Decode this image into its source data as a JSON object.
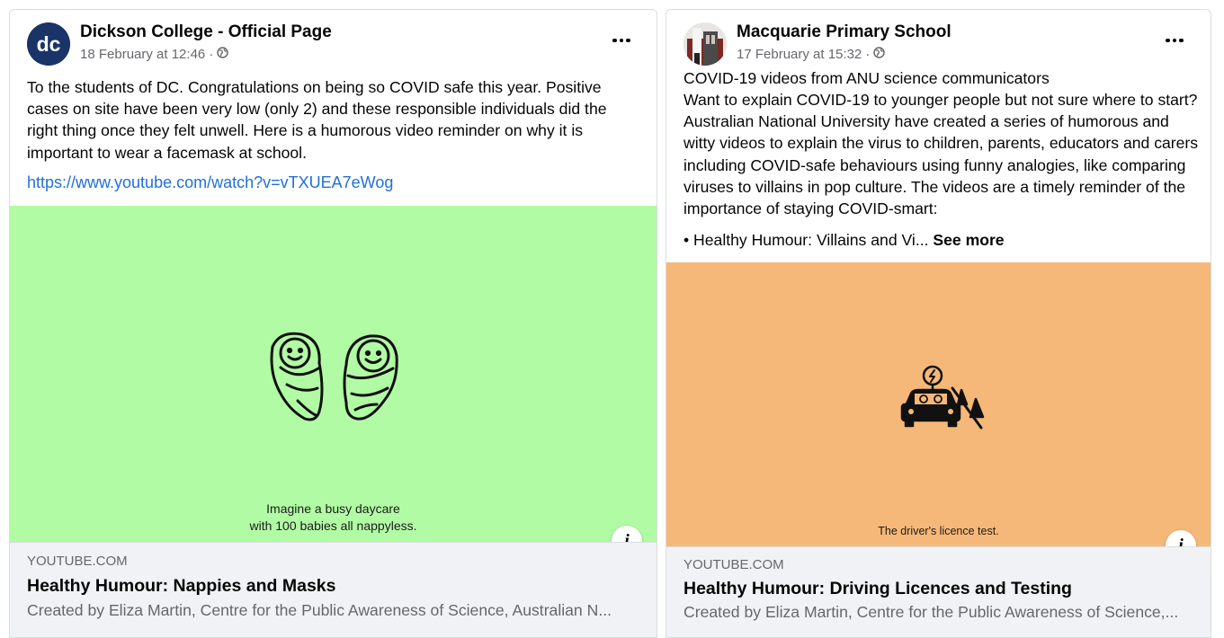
{
  "posts": [
    {
      "page_name": "Dickson College - Official Page",
      "avatar_text": "dc",
      "timestamp": "18 February at 12:46 · ",
      "privacy_icon": "globe-icon",
      "more_icon": "more-options-icon",
      "body": "To the students of DC. Congratulations on being so COVID safe this year. Positive cases on site have been very low (only 2) and these responsible individuals did the right thing once they felt unwell. Here is a humorous video reminder on why it is important to wear a facemask at school.",
      "link": "https://www.youtube.com/watch?v=vTXUEA7eWog",
      "media": {
        "background": "#b2fba5",
        "caption_line1": "Imagine a busy daycare",
        "caption_line2": "with 100 babies all nappyless.",
        "icon": "swaddled-babies-icon"
      },
      "preview": {
        "domain": "YOUTUBE.COM",
        "title": "Healthy Humour: Nappies and Masks",
        "description": "Created by Eliza Martin, Centre for the Public Awareness of Science, Australian N..."
      }
    },
    {
      "page_name": "Macquarie Primary School",
      "timestamp": "17 February at 15:32 · ",
      "privacy_icon": "globe-icon",
      "more_icon": "more-options-icon",
      "body_line1": "COVID-19 videos from ANU science communicators",
      "body": "Want to explain COVID-19 to younger people but not sure where to start? Australian National University have created a series of humorous and witty videos to explain the virus to children, parents, educators and carers including COVID-safe behaviours using funny analogies, like comparing viruses to villains in pop culture. The videos are a timely reminder of the importance of staying COVID-smart:",
      "bullet": "• Healthy Humour: Villains and Vi... ",
      "see_more": "See more",
      "media": {
        "background": "#f6b878",
        "caption": "The driver's licence test.",
        "icon": "car-driving-test-icon"
      },
      "preview": {
        "domain": "YOUTUBE.COM",
        "title": "Healthy Humour: Driving Licences and Testing",
        "description": "Created by Eliza Martin, Centre for the Public Awareness of Science,..."
      }
    }
  ],
  "colors": {
    "link": "#216fdb",
    "secondary_text": "#65676b",
    "preview_bg": "#f0f2f5",
    "dc_avatar": "#1a3468"
  }
}
